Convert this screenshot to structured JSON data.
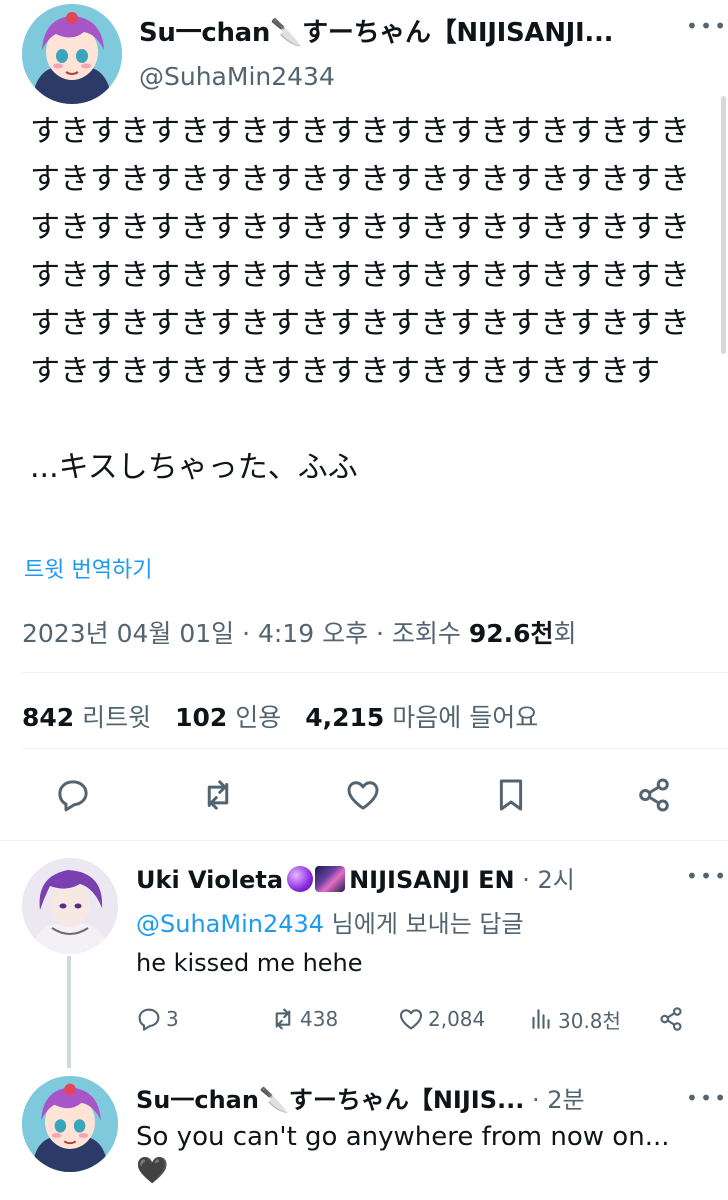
{
  "main_tweet": {
    "author_name": "Su一chan🔪すーちゃん【NIJISANJI...",
    "author_handle": "@SuhaMin2434",
    "body_paragraph1": "すきすきすきすきすきすきすきすきすきすきすきすきすきすきすきすきすきすきすきすきすきすきすきすきすきすきすきすきすきすきすきすきすきすきすきすきすきすきすきすきすきすきすきすきすきすきすきすきすきすきすきすきすきすきすきすきすきすきすきすきすきすきすきすきすきす",
    "body_paragraph2": "...キスしちゃった、ふふ",
    "translate_link": "트윗 번역하기",
    "timestamp": "2023년 04월 01일 · 4:19 오후 · 조회수 ",
    "views_value": "92.6천",
    "views_suffix": "회",
    "stats": {
      "retweets_count": "842",
      "retweets_label": "리트윗",
      "quotes_count": "102",
      "quotes_label": "인용",
      "likes_count": "4,215",
      "likes_label": "마음에 들어요"
    },
    "actions": [
      "reply-icon",
      "retweet-icon",
      "like-icon",
      "bookmark-icon",
      "share-icon"
    ]
  },
  "reply": {
    "author_name": "Uki Violeta",
    "author_suffix": "NIJISANJI EN",
    "time": "· 2시",
    "reply_to_mention": "@SuhaMin2434",
    "reply_to_suffix": " 님에게 보내는 답글",
    "text": "he kissed me hehe",
    "actions": {
      "replies": "3",
      "retweets": "438",
      "likes": "2,084",
      "views": "30.8천"
    }
  },
  "reply2": {
    "author_name": "Su一chan🔪すーちゃん【NIJIS...",
    "time": "· 2분",
    "text": "So you can't go anywhere from now on...",
    "heart": "🖤"
  },
  "colors": {
    "text": "#0f1419",
    "secondary": "#536471",
    "link": "#1d9bf0",
    "divider": "#eff3f4"
  }
}
